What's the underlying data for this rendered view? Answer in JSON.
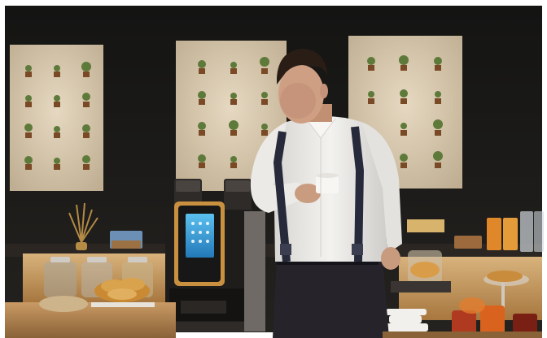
{
  "photo": {
    "machine_brand": "",
    "colors": {
      "wall": "#1c1c1a",
      "panel": "#d9cbb3",
      "machine_trim": "#c9913f",
      "screen": "#3aa6e0",
      "shirt": "#e9e8e5",
      "trousers": "#26242a",
      "counter": "#b98d5a"
    },
    "icons": [
      "potted-plant-icon",
      "coffee-cup-icon"
    ]
  }
}
